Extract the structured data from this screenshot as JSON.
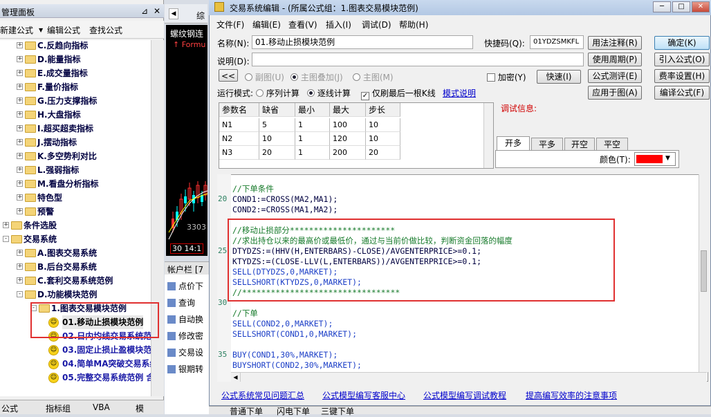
{
  "left_panel": {
    "title": "管理面板",
    "pin": "⊿",
    "close": "✕",
    "toolbar": {
      "new_formula": "新建公式",
      "edit_formula": "编辑公式",
      "find_formula": "查找公式"
    },
    "tree": [
      {
        "label": "C.反趋向指标",
        "type": "folder"
      },
      {
        "label": "D.能量指标",
        "type": "folder"
      },
      {
        "label": "E.成交量指标",
        "type": "folder"
      },
      {
        "label": "F.量价指标",
        "type": "folder"
      },
      {
        "label": "G.压力支撑指标",
        "type": "folder"
      },
      {
        "label": "H.大盘指标",
        "type": "folder"
      },
      {
        "label": "I.超买超卖指标",
        "type": "folder"
      },
      {
        "label": "J.摆动指标",
        "type": "folder"
      },
      {
        "label": "K.多空势利对比",
        "type": "folder"
      },
      {
        "label": "L.强弱指标",
        "type": "folder"
      },
      {
        "label": "M.看盘分析指标",
        "type": "folder"
      },
      {
        "label": "特色型",
        "type": "folder"
      },
      {
        "label": "预警",
        "type": "folder"
      },
      {
        "label": "条件选股",
        "type": "folder"
      },
      {
        "label": "交易系统",
        "type": "folder"
      },
      {
        "label": "A.图表交易系统",
        "type": "folder"
      },
      {
        "label": "B.后台交易系统",
        "type": "folder"
      },
      {
        "label": "C.套利交易系统范例",
        "type": "folder"
      },
      {
        "label": "D.功能模块范例",
        "type": "folder"
      },
      {
        "label": "1.图表交易模块范例",
        "type": "folder"
      },
      {
        "label": "01.移动止损模块范例",
        "type": "formula"
      },
      {
        "label": "02.日内均线交易系统范",
        "type": "formula"
      },
      {
        "label": "03.固定止损止盈模块范",
        "type": "formula"
      },
      {
        "label": "04.简单MA突破交易系统",
        "type": "formula"
      },
      {
        "label": "05.完整交易系统范例 含",
        "type": "formula"
      }
    ],
    "tabs": {
      "formula": "公式",
      "indicator_group": "指标组",
      "vba": "VBA",
      "other": "模"
    }
  },
  "middle": {
    "tab_label": "综",
    "chart_title": "螺纹钢连",
    "chart_sub": "Formu",
    "chart_price": "3303",
    "chart_time": "30 14:1",
    "account_bar": "帐户栏 [7",
    "account_items": [
      "点价下",
      "查询",
      "自动换",
      "修改密",
      "交易设",
      "银期转"
    ]
  },
  "dialog": {
    "title": "交易系统编辑 - (所属公式组：1.图表交易模块范例)",
    "menu": [
      "文件(F)",
      "编辑(E)",
      "查看(V)",
      "插入(I)",
      "调试(D)",
      "帮助(H)"
    ],
    "name_label": "名称(N):",
    "name_value": "01.移动止损模块范例",
    "shortcut_label": "快捷码(Q):",
    "shortcut_value": "01YDZSMKFL",
    "desc_label": "说明(D):",
    "desc_value": "",
    "collapse_btn": "<<",
    "radio_sub": "副图(U)",
    "radio_main_overlay": "主图叠加(J)",
    "radio_main": "主图(M)",
    "encrypt": "加密(Y)",
    "fast_btn": "快速(I)",
    "run_mode_label": "运行模式:",
    "run_seq": "序列计算",
    "run_line": "逐线计算",
    "run_last": "仅刷最后一根K线",
    "mode_help": "模式说明",
    "buttons_right": [
      [
        "用法注释(R)",
        "确定(K)"
      ],
      [
        "使用周期(P)",
        "引入公式(O)"
      ],
      [
        "公式测评(E)",
        "费率设置(H)"
      ],
      [
        "应用于图(A)",
        "编译公式(F)"
      ]
    ],
    "debug_label": "调试信息:",
    "params": {
      "headers": [
        "参数名",
        "缺省",
        "最小",
        "最大",
        "步长"
      ],
      "rows": [
        [
          "N1",
          "5",
          "1",
          "100",
          "10"
        ],
        [
          "N2",
          "10",
          "1",
          "120",
          "10"
        ],
        [
          "N3",
          "20",
          "1",
          "200",
          "20"
        ]
      ]
    },
    "right_tabs": [
      "开多",
      "平多",
      "开空",
      "平空"
    ],
    "color_label": "颜色(T):",
    "color_value": "#ff0000",
    "code": [
      {
        "n": "",
        "t": "//下单条件",
        "c": "cm"
      },
      {
        "n": "20",
        "t": "COND1:=CROSS(MA2,MA1);",
        "c": "pl"
      },
      {
        "n": "",
        "t": "COND2:=CROSS(MA1,MA2);",
        "c": "pl"
      },
      {
        "n": "",
        "t": "",
        "c": "pl"
      },
      {
        "n": "",
        "t": "//移动止损部分**********************",
        "c": "cm"
      },
      {
        "n": "",
        "t": "//求出持仓以来的最高价或最低价，通过与当前价做比较，判断资金回落的幅度",
        "c": "cm"
      },
      {
        "n": "25",
        "t": "DTYDZS:=(HHV(H,ENTERBARS)-CLOSE)/AVGENTERPRICE>=0.1;",
        "c": "pl"
      },
      {
        "n": "",
        "t": "KTYDZS:=(CLOSE-LLV(L,ENTERBARS))/AVGENTERPRICE>=0.1;",
        "c": "pl"
      },
      {
        "n": "",
        "t": "SELL(DTYDZS,0,MARKET);",
        "c": "kw"
      },
      {
        "n": "",
        "t": "SELLSHORT(KTYDZS,0,MARKET);",
        "c": "kw"
      },
      {
        "n": "",
        "t": "//*********************************",
        "c": "cm"
      },
      {
        "n": "30",
        "t": "",
        "c": "pl"
      },
      {
        "n": "",
        "t": "//下单",
        "c": "cm"
      },
      {
        "n": "",
        "t": "SELL(COND2,0,MARKET);",
        "c": "kw"
      },
      {
        "n": "",
        "t": "SELLSHORT(COND1,0,MARKET);",
        "c": "kw"
      },
      {
        "n": "",
        "t": "",
        "c": "pl"
      },
      {
        "n": "35",
        "t": "BUY(COND1,30%,MARKET);",
        "c": "kw"
      },
      {
        "n": "",
        "t": "BUYSHORT(COND2,30%,MARKET);",
        "c": "kw"
      }
    ],
    "links": [
      "公式系统常见问题汇总",
      "公式模型编写客服中心",
      "公式模型编写调试教程",
      "提高编写效率的注意事项"
    ]
  },
  "bottom_bar": [
    "普通下单",
    "闪电下单",
    "三键下单"
  ]
}
